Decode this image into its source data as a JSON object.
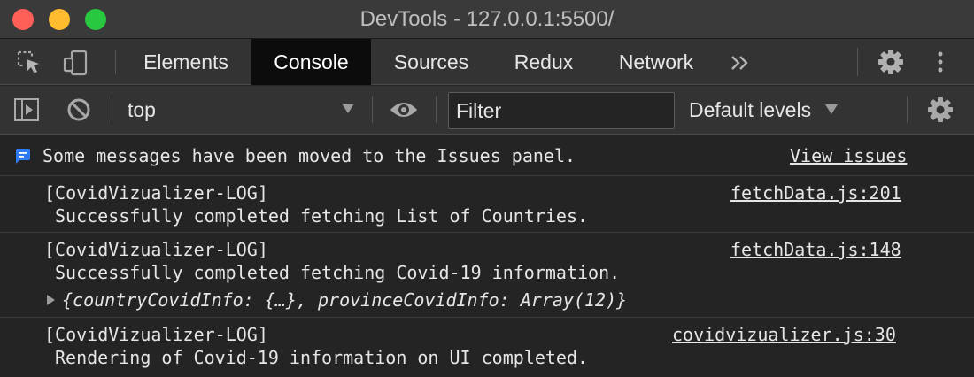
{
  "window": {
    "title": "DevTools - 127.0.0.1:5500/"
  },
  "tabs": [
    {
      "label": "Elements"
    },
    {
      "label": "Console"
    },
    {
      "label": "Sources"
    },
    {
      "label": "Redux"
    },
    {
      "label": "Network"
    }
  ],
  "active_tab": "Console",
  "toolbar": {
    "context": "top",
    "filter_placeholder": "Filter",
    "levels": "Default levels"
  },
  "console": {
    "issues_notice": "Some messages have been moved to the Issues panel.",
    "view_issues": "View issues",
    "messages": [
      {
        "source": "fetchData.js:201",
        "prefix": "[CovidVizualizer-LOG]",
        "text": "Successfully completed fetching List of Countries."
      },
      {
        "source": "fetchData.js:148",
        "prefix": "[CovidVizualizer-LOG]",
        "text": "Successfully completed fetching Covid-19 information.",
        "object": "{countryCovidInfo: {…}, provinceCovidInfo: Array(12)}"
      },
      {
        "source": "covidvizualizer.js:30",
        "prefix": "[CovidVizualizer-LOG]",
        "text": "Rendering of Covid-19 information on UI completed."
      }
    ]
  },
  "colors": {
    "titlebar": "#3a3a3a",
    "panel": "#333333",
    "console_bg": "#242424",
    "active_tab": "#0c0c0c",
    "info_icon": "#2f7bf5"
  }
}
